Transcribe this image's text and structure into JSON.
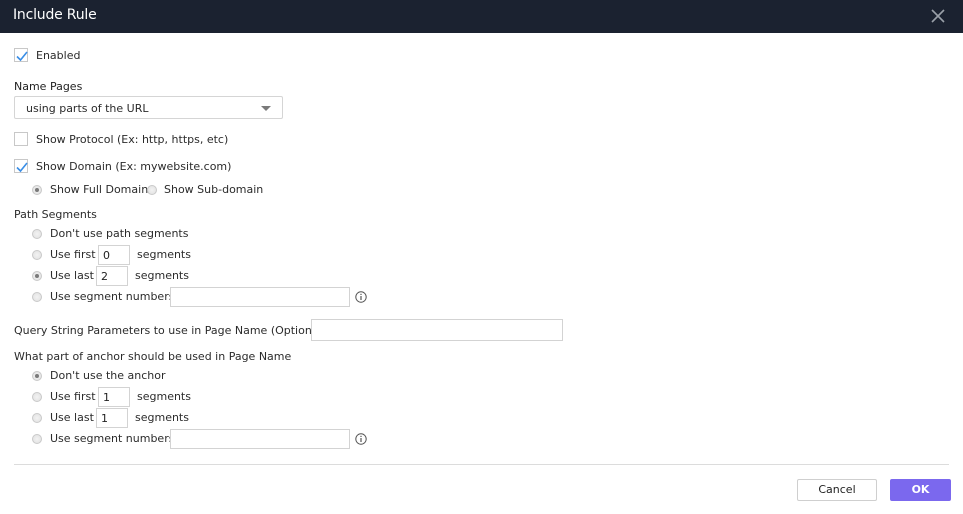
{
  "dialog": {
    "title": "Include Rule",
    "close_icon": "close-icon"
  },
  "enabled": {
    "label": "Enabled",
    "checked": true
  },
  "name_pages": {
    "label": "Name Pages",
    "selected": "using parts of the URL"
  },
  "show_protocol": {
    "label": "Show Protocol (Ex: http, https, etc)",
    "checked": false
  },
  "show_domain": {
    "label": "Show Domain (Ex: mywebsite.com)",
    "checked": true,
    "options": [
      {
        "label": "Show Full Domain",
        "selected": true
      },
      {
        "label": "Show Sub-domain",
        "selected": false
      }
    ]
  },
  "path_segments": {
    "label": "Path Segments",
    "options": [
      {
        "label": "Don't use path segments",
        "selected": false
      },
      {
        "label": "Use first",
        "value": "0",
        "suffix": "segments",
        "selected": false
      },
      {
        "label": "Use last",
        "value": "2",
        "suffix": "segments",
        "selected": true
      },
      {
        "label": "Use segment numbers",
        "value": "",
        "selected": false
      }
    ]
  },
  "query_string": {
    "label": "Query String Parameters to use in Page Name (Optional)",
    "value": ""
  },
  "anchor": {
    "label": "What part of anchor should be used in Page Name",
    "options": [
      {
        "label": "Don't use the anchor",
        "selected": true
      },
      {
        "label": "Use first",
        "value": "1",
        "suffix": "segments",
        "selected": false
      },
      {
        "label": "Use last",
        "value": "1",
        "suffix": "segments",
        "selected": false
      },
      {
        "label": "Use segment numbers",
        "value": "",
        "selected": false
      }
    ]
  },
  "footer": {
    "cancel_label": "Cancel",
    "ok_label": "OK",
    "accent_color": "#7b68ee"
  }
}
